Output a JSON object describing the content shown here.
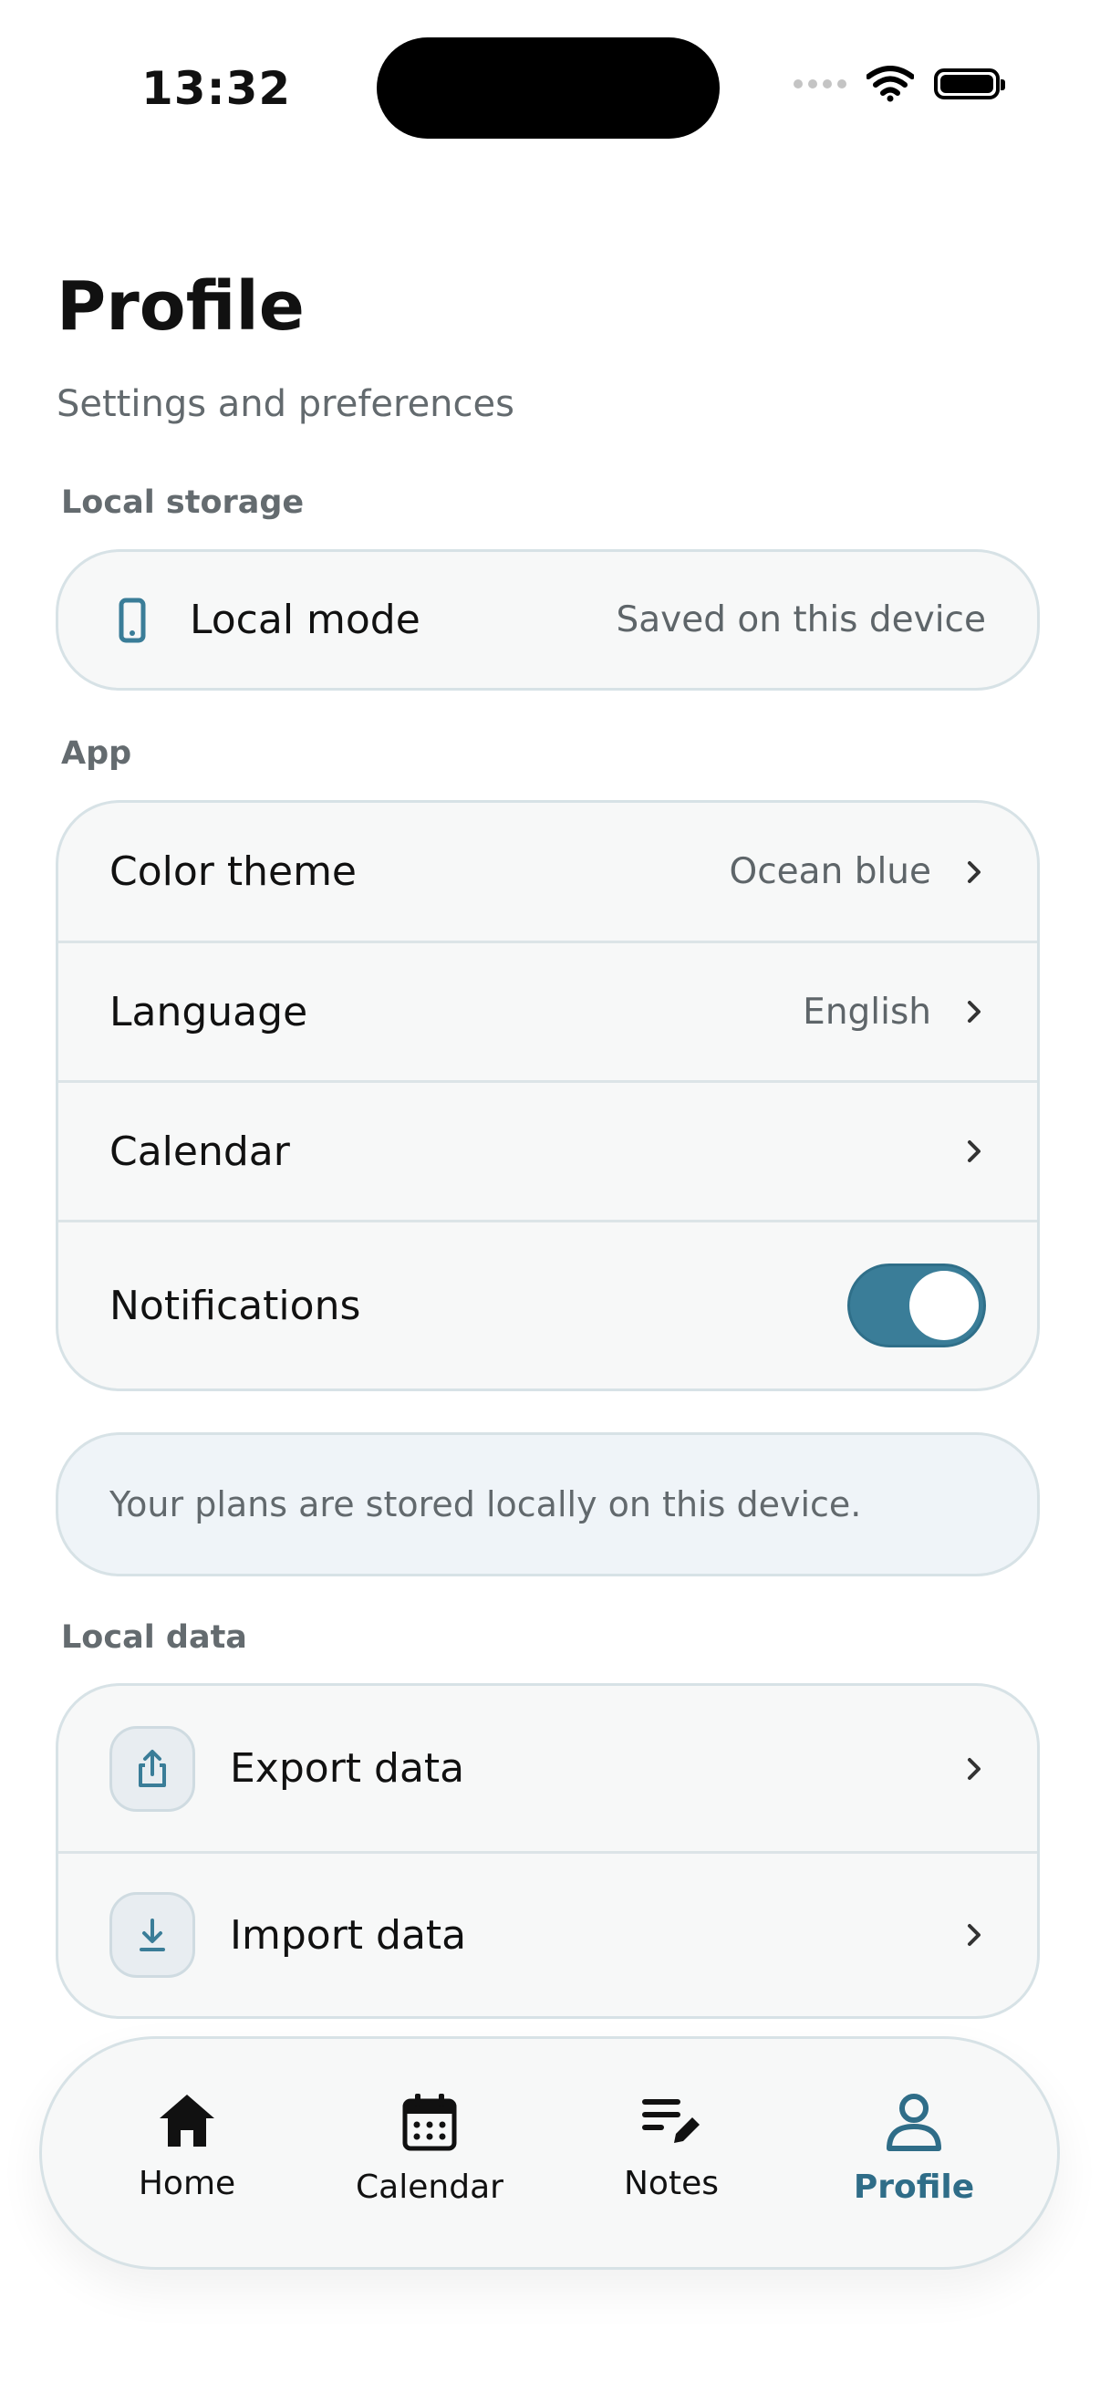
{
  "status_bar": {
    "time": "13:32"
  },
  "header": {
    "title": "Profile",
    "subtitle": "Settings and preferences"
  },
  "sections": {
    "local_storage": {
      "label": "Local storage",
      "row": {
        "icon": "phone-icon",
        "label": "Local mode",
        "value": "Saved on this device"
      }
    },
    "app": {
      "label": "App",
      "rows": [
        {
          "label": "Color theme",
          "value": "Ocean blue"
        },
        {
          "label": "Language",
          "value": "English"
        },
        {
          "label": "Calendar",
          "value": ""
        },
        {
          "label": "Notifications",
          "toggle_on": true
        }
      ]
    },
    "info_text": "Your plans are stored locally on this device.",
    "local_data": {
      "label": "Local data",
      "rows": [
        {
          "icon": "export-icon",
          "label": "Export data"
        },
        {
          "icon": "import-icon",
          "label": "Import data"
        }
      ]
    }
  },
  "tabbar": {
    "active": "Profile",
    "tabs": [
      {
        "icon": "home-icon",
        "label": "Home"
      },
      {
        "icon": "calendar-icon",
        "label": "Calendar"
      },
      {
        "icon": "notes-icon",
        "label": "Notes"
      },
      {
        "icon": "profile-icon",
        "label": "Profile"
      }
    ]
  },
  "colors": {
    "accent": "#3a7d98",
    "accent_text": "#2f6d88",
    "card_bg": "#f7f8f8",
    "card_border": "#d7e2e6",
    "info_bg": "#eff4f8",
    "muted_text": "#5e6569"
  }
}
